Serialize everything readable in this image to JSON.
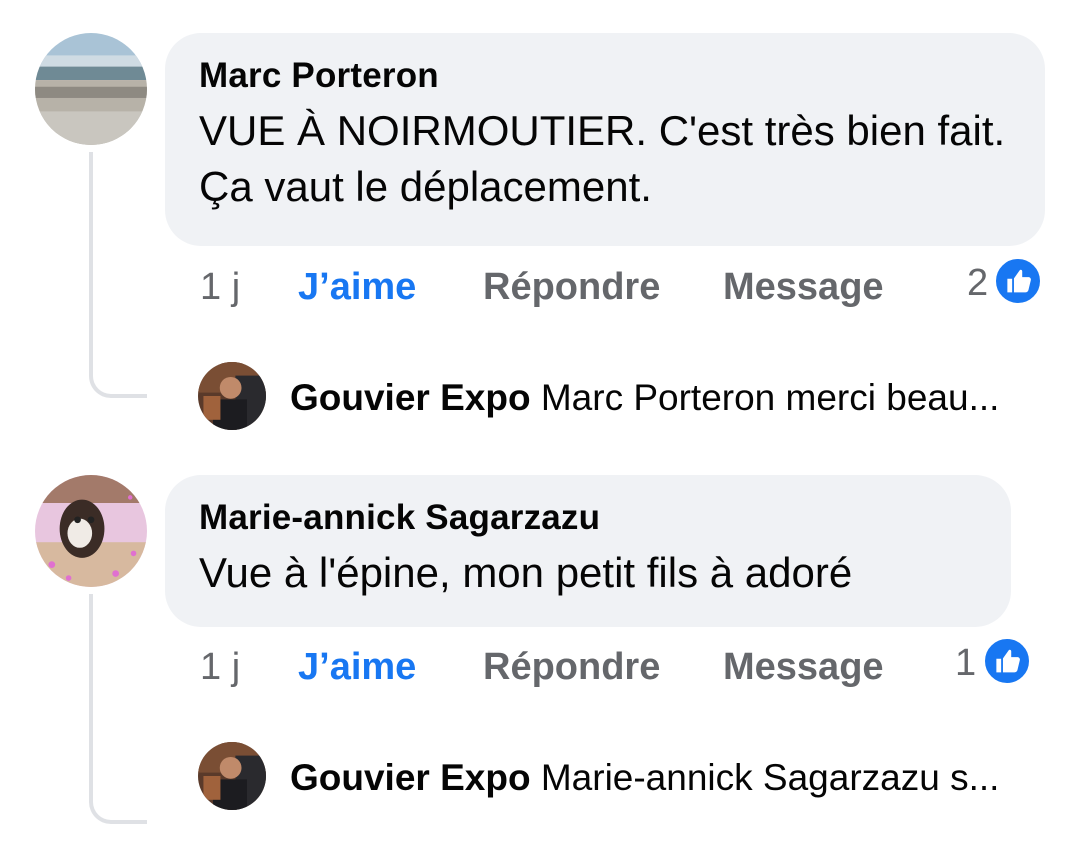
{
  "comments": [
    {
      "author": "Marc Porteron",
      "text": "VUE À NOIRMOUTIER. C'est très bien fait. Ça vaut le déplacement.",
      "time": "1 j",
      "like_label": "J’aime",
      "reply_label": "Répondre",
      "message_label": "Message",
      "reaction_count": "2",
      "reaction_icon": "like-icon",
      "reply_preview": {
        "author": "Gouvier Expo",
        "text": "Marc Porteron merci beau..."
      }
    },
    {
      "author": "Marie-annick Sagarzazu",
      "text": "Vue à l'épine, mon petit fils à adoré",
      "time": "1 j",
      "like_label": "J’aime",
      "reply_label": "Répondre",
      "message_label": "Message",
      "reaction_count": "1",
      "reaction_icon": "like-icon",
      "reply_preview": {
        "author": "Gouvier Expo",
        "text": "Marie-annick Sagarzazu s..."
      }
    }
  ],
  "colors": {
    "bubble": "#f0f2f5",
    "like_blue": "#1877f2",
    "secondary_text": "#65676b",
    "thread_line": "#dfe1e5"
  }
}
